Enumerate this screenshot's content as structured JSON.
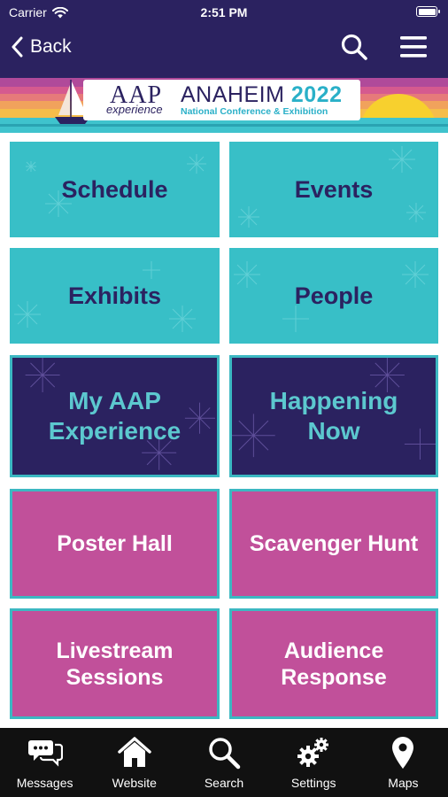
{
  "status_bar": {
    "carrier": "Carrier",
    "time": "2:51 PM",
    "battery_level": 1.0
  },
  "nav": {
    "back_label": "Back",
    "search_icon": "search-icon",
    "menu_icon": "hamburger-menu-icon"
  },
  "banner": {
    "logo_aap": "AAP",
    "logo_experience": "experience",
    "city": "ANAHEIM",
    "year": "2022",
    "subtitle": "National Conference & Exhibition"
  },
  "tiles": [
    {
      "label": "Schedule",
      "style": "teal"
    },
    {
      "label": "Events",
      "style": "teal"
    },
    {
      "label": "Exhibits",
      "style": "teal"
    },
    {
      "label": "People",
      "style": "teal"
    },
    {
      "label_line1": "My AAP",
      "label_line2": "Experience",
      "style": "navy"
    },
    {
      "label_line1": "Happening",
      "label_line2": "Now",
      "style": "navy"
    },
    {
      "label": "Poster Hall",
      "style": "pink"
    },
    {
      "label": "Scavenger Hunt",
      "style": "pink"
    },
    {
      "label_line1": "Livestream",
      "label_line2": "Sessions",
      "style": "pink"
    },
    {
      "label_line1": "Audience",
      "label_line2": "Response",
      "style": "pink"
    }
  ],
  "tab_bar": [
    {
      "label": "Messages",
      "icon": "messages-icon"
    },
    {
      "label": "Website",
      "icon": "home-icon"
    },
    {
      "label": "Search",
      "icon": "search-icon"
    },
    {
      "label": "Settings",
      "icon": "gears-icon"
    },
    {
      "label": "Maps",
      "icon": "map-pin-icon"
    }
  ],
  "colors": {
    "nav_bg": "#2b2260",
    "teal": "#38bfc7",
    "navy": "#2b2260",
    "pink": "#c1509a",
    "tab_bg": "#111111"
  }
}
